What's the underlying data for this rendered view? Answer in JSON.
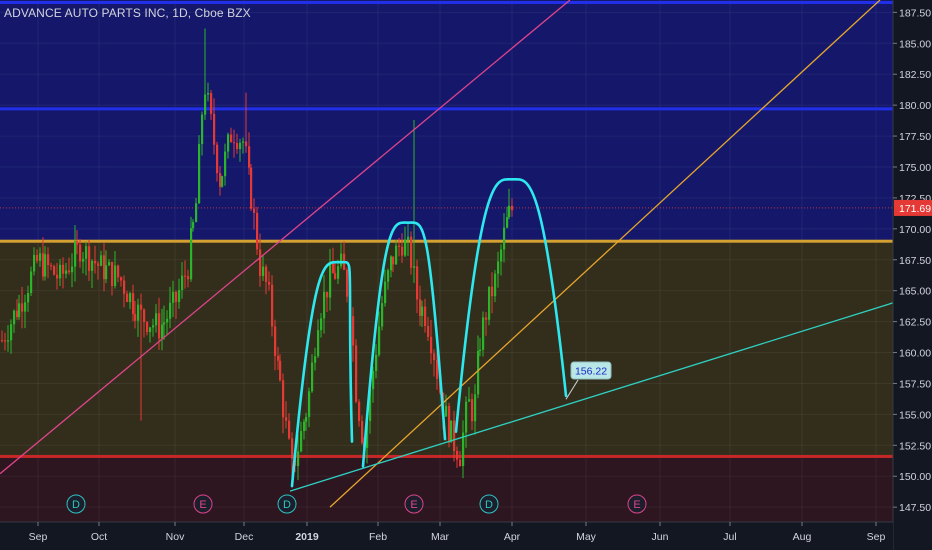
{
  "title": "ADVANCE AUTO PARTS INC, 1D, Cboe BZX",
  "chart_data": {
    "type": "candlestick",
    "title": "ADVANCE AUTO PARTS INC, 1D, Cboe BZX",
    "x_axis": {
      "tick_labels": [
        "Sep",
        "Oct",
        "Nov",
        "Dec",
        "2019",
        "Feb",
        "Mar",
        "Apr",
        "May",
        "Jun",
        "Jul",
        "Aug",
        "Sep"
      ],
      "bold_ticks": [
        "2019"
      ]
    },
    "y_axis": {
      "range": [
        146.3,
        188.5
      ],
      "ticks": [
        147.5,
        150.0,
        152.5,
        155.0,
        157.5,
        160.0,
        162.5,
        165.0,
        167.5,
        170.0,
        172.5,
        175.0,
        177.5,
        180.0,
        182.5,
        185.0,
        187.5
      ],
      "tick_labels": [
        "147.50",
        "150.00",
        "152.50",
        "155.00",
        "157.50",
        "160.00",
        "162.50",
        "165.00",
        "167.50",
        "170.00",
        "172.50",
        "175.00",
        "177.50",
        "180.00",
        "182.50",
        "185.00",
        "187.50"
      ],
      "position": "right"
    },
    "last_price": {
      "value": 171.69,
      "label": "171.69",
      "color": "#e53935"
    },
    "horizontal_levels": [
      {
        "value": 188.3,
        "color": "#2130e8"
      },
      {
        "value": 179.7,
        "color": "#2130e8"
      },
      {
        "value": 169.0,
        "color": "#d4a032"
      },
      {
        "value": 151.6,
        "color": "#c62828"
      }
    ],
    "zones": [
      {
        "from": 169.0,
        "to": 188.5,
        "color": "#15186a"
      },
      {
        "from": 151.6,
        "to": 169.0,
        "color": "#332e1c"
      },
      {
        "from": 146.3,
        "to": 151.6,
        "color": "#2d1620"
      }
    ],
    "callout": {
      "value": 156.22,
      "label": "156.22"
    },
    "event_markers": [
      {
        "label": "D",
        "color": "#2ec4c4"
      },
      {
        "label": "E",
        "color": "#e0448c"
      },
      {
        "label": "D",
        "color": "#2ec4c4"
      },
      {
        "label": "E",
        "color": "#e0448c"
      },
      {
        "label": "D",
        "color": "#2ec4c4"
      },
      {
        "label": "E",
        "color": "#e0448c"
      }
    ],
    "colors": {
      "bullish": "#2bb52b",
      "bearish": "#e53935",
      "arc": "#2ee8f0",
      "trendline_teal": "#2ed1c4",
      "trendline_orange": "#e6a52c",
      "trendline_pink": "#e0448c",
      "text": "#d1d4dc"
    }
  }
}
